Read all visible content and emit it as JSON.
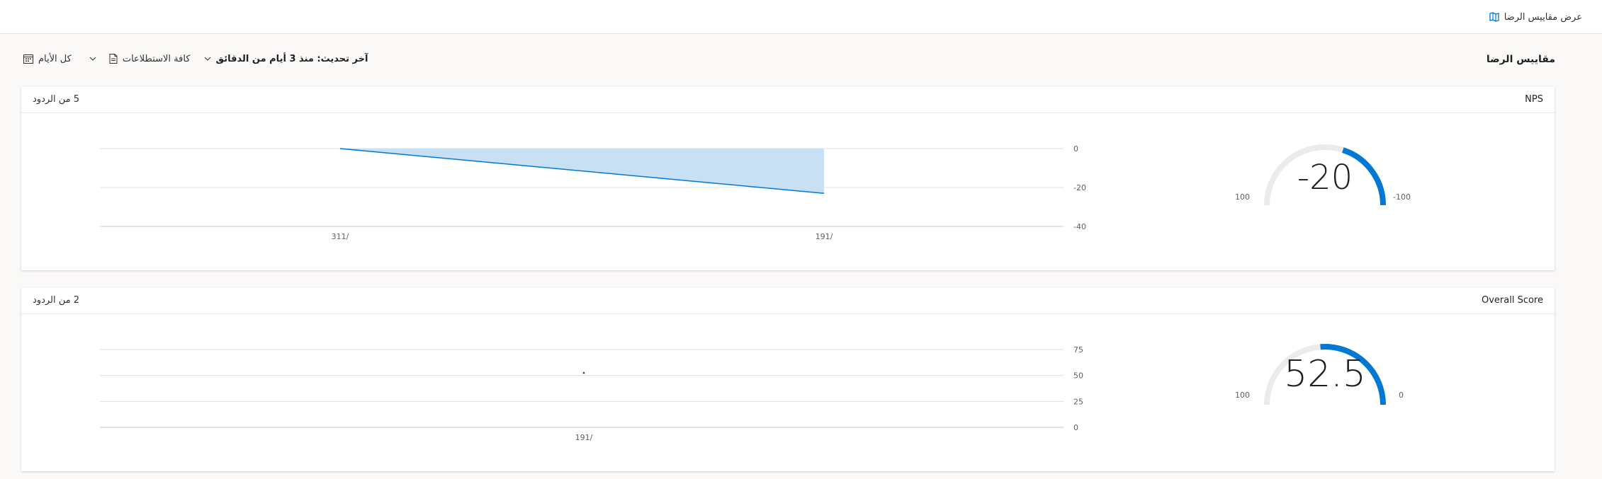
{
  "header": {
    "title": "عرض مقاييس الرضا",
    "icon": "survey-metrics-icon"
  },
  "commandbar": {
    "page_title": "مقاييس الرضا",
    "date_filter": "كل الأيام",
    "survey_filter": "كافة الاستطلاعات",
    "last_updated": "آخر تحديث: منذ 3 أيام من الدقائق"
  },
  "accent": "#0078d4",
  "cards": [
    {
      "name": "NPS",
      "responses": "5 من الردود",
      "gauge": {
        "value": -20,
        "display": "-20",
        "min_label": "-100",
        "max_label": "100",
        "min": -100,
        "max": 100
      },
      "chart_data": {
        "type": "area",
        "x": [
          "311/",
          "191/"
        ],
        "values": [
          0,
          -23
        ],
        "ylim": [
          -40,
          0
        ],
        "yticks": [
          "0",
          "-20",
          "-40"
        ],
        "grid": true
      }
    },
    {
      "name": "Overall Score",
      "responses": "2 من الردود",
      "gauge": {
        "value": 52.5,
        "display": "52.5",
        "min_label": "0",
        "max_label": "100",
        "min": 0,
        "max": 100
      },
      "chart_data": {
        "type": "scatter",
        "x": [
          "191/"
        ],
        "values": [
          52.5
        ],
        "ylim": [
          0,
          75
        ],
        "yticks": [
          "75",
          "50",
          "25",
          "0"
        ],
        "grid": true
      }
    }
  ]
}
